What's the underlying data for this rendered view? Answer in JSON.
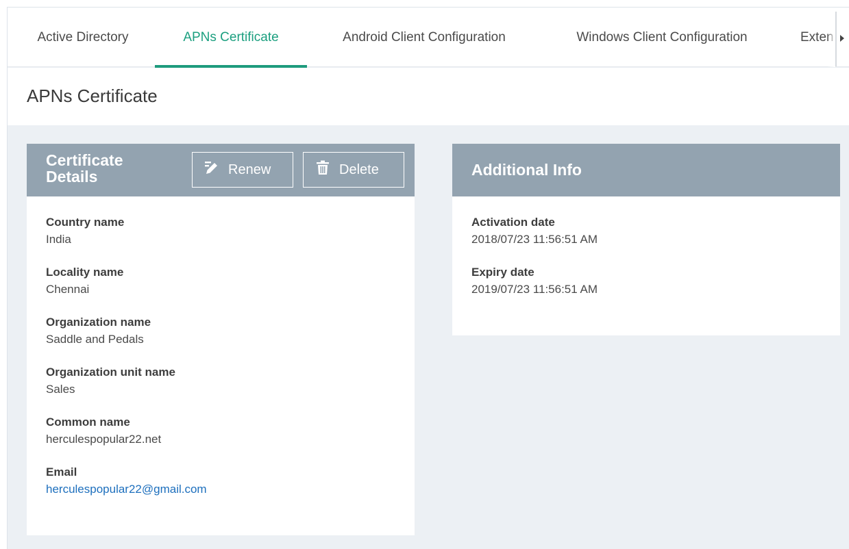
{
  "tabs": [
    {
      "label": "Active Directory",
      "active": false
    },
    {
      "label": "APNs Certificate",
      "active": true
    },
    {
      "label": "Android Client Configuration",
      "active": false
    },
    {
      "label": "Windows Client Configuration",
      "active": false
    },
    {
      "label": "Exten",
      "active": false
    }
  ],
  "page": {
    "title": "APNs Certificate"
  },
  "certificate_card": {
    "title": "Certificate Details",
    "title_line1": "Certificate",
    "title_line2": "Details",
    "renew_label": "Renew",
    "delete_label": "Delete",
    "fields": [
      {
        "label": "Country name",
        "value": "India"
      },
      {
        "label": "Locality name",
        "value": "Chennai"
      },
      {
        "label": "Organization name",
        "value": "Saddle and Pedals"
      },
      {
        "label": "Organization unit name",
        "value": "Sales"
      },
      {
        "label": "Common name",
        "value": "herculespopular22.net"
      },
      {
        "label": "Email",
        "value": "herculespopular22@gmail.com"
      }
    ]
  },
  "additional_card": {
    "title": "Additional Info",
    "fields": [
      {
        "label": "Activation date",
        "value": "2018/07/23 11:56:51 AM"
      },
      {
        "label": "Expiry date",
        "value": "2019/07/23 11:56:51 AM"
      }
    ]
  },
  "colors": {
    "accent": "#1e9b7d",
    "card_header": "#93a3b0",
    "page_background": "#ecf0f4",
    "link": "#1d6fbd"
  },
  "icons": {
    "renew": "pencil-icon",
    "delete": "trash-icon",
    "tab_overflow": "chevron-right-icon"
  }
}
